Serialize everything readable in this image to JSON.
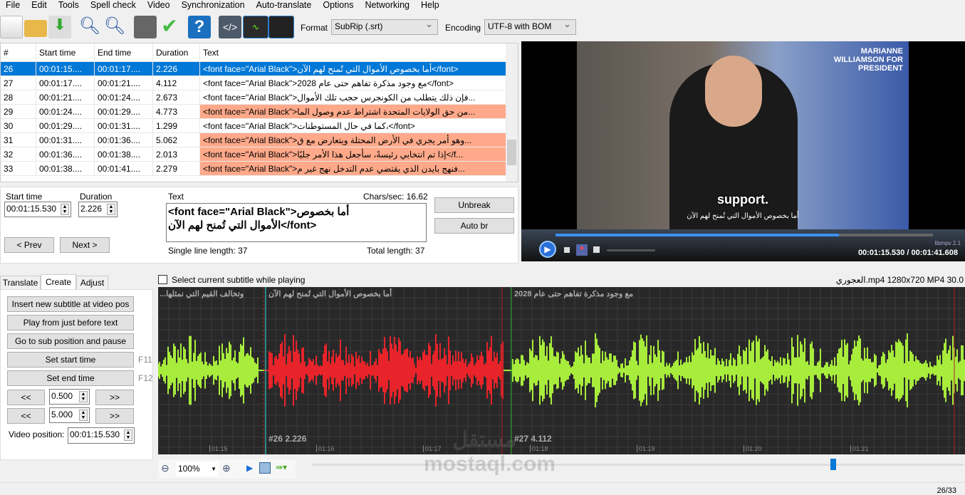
{
  "menu": [
    "File",
    "Edit",
    "Tools",
    "Spell check",
    "Video",
    "Synchronization",
    "Auto-translate",
    "Options",
    "Networking",
    "Help"
  ],
  "toolbar": {
    "icons": [
      "new-file-icon",
      "open-folder-icon",
      "save-download-icon",
      "find-icon",
      "replace-icon",
      "visual-sync-icon",
      "spell-check-icon",
      "help-icon",
      "source-view-icon",
      "waveform-toggle-icon",
      "video-toggle-icon"
    ],
    "format_label": "Format",
    "format_value": "SubRip (.srt)",
    "encoding_label": "Encoding",
    "encoding_value": "UTF-8 with BOM"
  },
  "grid": {
    "headers": [
      "#",
      "Start time",
      "End time",
      "Duration",
      "Text"
    ],
    "rows": [
      {
        "n": "26",
        "start": "00:01:15....",
        "end": "00:01:17....",
        "dur": "2.226",
        "text": "<font face=\"Arial Black\">أما بخصوص الأموال التي تُمنح لهم الآن</font>",
        "state": "selected"
      },
      {
        "n": "27",
        "start": "00:01:17....",
        "end": "00:01:21....",
        "dur": "4.112",
        "text": "<font face=\"Arial Black\">مع وجود مذكرة تفاهم حتى عام 2028</font>",
        "state": "normal"
      },
      {
        "n": "28",
        "start": "00:01:21....",
        "end": "00:01:24....",
        "dur": "2.673",
        "text": "<font face=\"Arial Black\">فإن ذلك يتطلب من الكونجرس حجب تلك الأموال...",
        "state": "normal"
      },
      {
        "n": "29",
        "start": "00:01:24....",
        "end": "00:01:29....",
        "dur": "4.773",
        "text": "<font face=\"Arial Black\">من حق الولايات المتحدة اشتراط عدم وصول الما...",
        "state": "error"
      },
      {
        "n": "30",
        "start": "00:01:29....",
        "end": "00:01:31....",
        "dur": "1.299",
        "text": "<font face=\"Arial Black\">كما في حال المستوطنات،</font>",
        "state": "normal"
      },
      {
        "n": "31",
        "start": "00:01:31....",
        "end": "00:01:36....",
        "dur": "5.062",
        "text": "<font face=\"Arial Black\">وهو أمر يجري في الأرض المحتلة ويتعارض مع ق...",
        "state": "error"
      },
      {
        "n": "32",
        "start": "00:01:36....",
        "end": "00:01:38....",
        "dur": "2.013",
        "text": "<font face=\"Arial Black\">إذا تم انتخابي رئيسةً، سأجعل هذا الأمر جليًا</f...",
        "state": "error"
      },
      {
        "n": "33",
        "start": "00:01:38....",
        "end": "00:01:41....",
        "dur": "2.279",
        "text": "<font face=\"Arial Black\">فنهج بايدن الذي يقتضي عدم التدخل نهج غير م...",
        "state": "error"
      }
    ]
  },
  "edit": {
    "start_label": "Start time",
    "start_value": "00:01:15.530",
    "duration_label": "Duration",
    "duration_value": "2.226",
    "text_label": "Text",
    "chars_sec": "Chars/sec: 16.62",
    "text_line1": "<font face=\"Arial Black\">أما بخصوص",
    "text_line2": "الأموال التي تُمنح لهم الآن</font>",
    "single_line": "Single line length: 37",
    "total": "Total length: 37",
    "prev": "< Prev",
    "next": "Next >",
    "unbreak": "Unbreak",
    "auto_br": "Auto br"
  },
  "video": {
    "subtitle_en": "support.",
    "subtitle_ar": "أما بخصوص الأموال التي تُمنح لهم الآن",
    "logo": "MARIANNE WILLIAMSON FOR PRESIDENT",
    "player": "libmpv 2.1",
    "time": "00:01:15.530 / 00:01:41.608",
    "progress": 0.75
  },
  "tabs": [
    "Translate",
    "Create",
    "Adjust"
  ],
  "create": {
    "insert": "Insert new subtitle at video pos",
    "play_before": "Play from just before text",
    "goto": "Go to sub position and pause",
    "set_start": "Set start time",
    "f11": "F11",
    "set_end": "Set end time",
    "f12": "F12",
    "back": "<<",
    "fwd": ">>",
    "step1": "0.500",
    "step2": "5.000",
    "video_pos_label": "Video position:",
    "video_pos": "00:01:15.530"
  },
  "waveform": {
    "select_label": "Select current subtitle while playing",
    "file_info": "العجوري.mp4 1280x720 MP4 30.0",
    "sub_prev": "...وتخالف القيم التي نمثلها",
    "sub_26": "أما بخصوص الأموال التي تُمنح لهم الآن",
    "sub_27": "مع وجود مذكرة تفاهم حتى عام 2028",
    "label_26": "#26  2.226",
    "label_27": "#27  4.112",
    "ticks": [
      "01:15",
      "01:16",
      "01:17",
      "01:18",
      "01:19",
      "01:20",
      "01:21"
    ],
    "zoom": "100%",
    "position_slider": 0.8
  },
  "watermark": "مستقل mostaql.com",
  "status": {
    "count": "26/33"
  },
  "colors": {
    "selected": "#0078d7",
    "error": "#ffa98a",
    "wave_green": "#a8ec3c",
    "wave_red": "#e8232a",
    "wave_bg": "#282828"
  }
}
